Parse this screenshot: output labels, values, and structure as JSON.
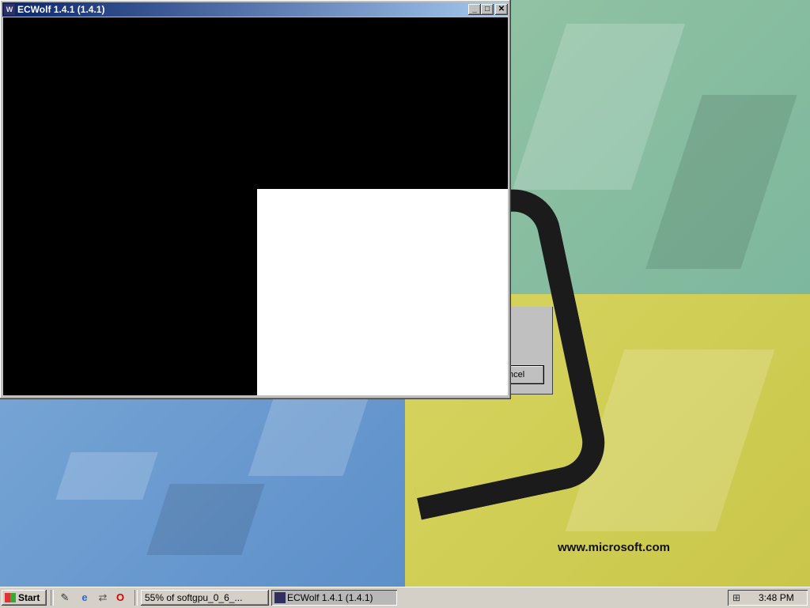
{
  "window": {
    "title": "ECWolf 1.4.1 (1.4.1)",
    "minimize": "_",
    "maximize": "□",
    "close": "✕"
  },
  "background_dialog": {
    "button_label": "ncel"
  },
  "desktop": {
    "watermark_url": "www.microsoft.com"
  },
  "taskbar": {
    "start_label": "Start",
    "quick_launch": [
      "show-desktop-icon",
      "internet-explorer-icon",
      "network-icon",
      "opera-icon"
    ],
    "tasks": [
      {
        "label": "55% of softgpu_0_6_...",
        "active": false
      },
      {
        "label": "ECWolf 1.4.1 (1.4.1)",
        "active": true
      }
    ],
    "clock": "3:48 PM"
  },
  "colors": {
    "titlebar_start": "#0a246a",
    "titlebar_end": "#a6caf0",
    "chrome": "#d4d0c8"
  }
}
